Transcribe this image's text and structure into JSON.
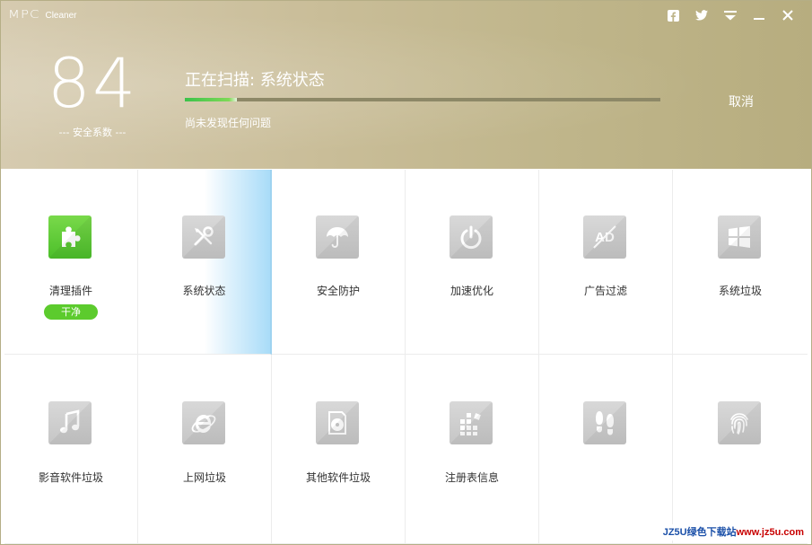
{
  "app": {
    "logo_mark": "MPC",
    "logo_text": "Cleaner"
  },
  "window_controls": [
    {
      "name": "facebook-icon"
    },
    {
      "name": "twitter-icon"
    },
    {
      "name": "menu-icon"
    },
    {
      "name": "minimize-icon"
    },
    {
      "name": "close-icon"
    }
  ],
  "score": {
    "value": "84",
    "label": "--- 安全系数 ---"
  },
  "scan": {
    "title": "正在扫描: 系统状态",
    "progress": 0.11,
    "status": "尚未发现任何问题",
    "cancel_label": "取消"
  },
  "modules": [
    {
      "label": "清理插件",
      "icon": "puzzle-icon",
      "badge": "干净",
      "state": "done"
    },
    {
      "label": "系统状态",
      "icon": "tools-icon",
      "state": "scanning"
    },
    {
      "label": "安全防护",
      "icon": "umbrella-icon",
      "state": "pending"
    },
    {
      "label": "加速优化",
      "icon": "power-icon",
      "state": "pending"
    },
    {
      "label": "广告过滤",
      "icon": "ad-block-icon",
      "icon_text": "AD",
      "state": "pending"
    },
    {
      "label": "系统垃圾",
      "icon": "windows-icon",
      "state": "pending"
    },
    {
      "label": "影音软件垃圾",
      "icon": "music-note-icon",
      "state": "pending"
    },
    {
      "label": "上网垃圾",
      "icon": "ie-icon",
      "state": "pending"
    },
    {
      "label": "其他软件垃圾",
      "icon": "disc-icon",
      "state": "pending"
    },
    {
      "label": "注册表信息",
      "icon": "registry-icon",
      "state": "pending"
    },
    {
      "label": "",
      "icon": "footprints-icon",
      "state": "pending"
    },
    {
      "label": "",
      "icon": "fingerprint-icon",
      "state": "pending"
    }
  ],
  "watermark": {
    "part1": "JZ5U绿色下载站",
    "part2": "www.jz5u.com"
  },
  "colors": {
    "accent_green": "#5ccb2d",
    "header": "#c4b98f",
    "scan_highlight": "#a9dcf8"
  }
}
